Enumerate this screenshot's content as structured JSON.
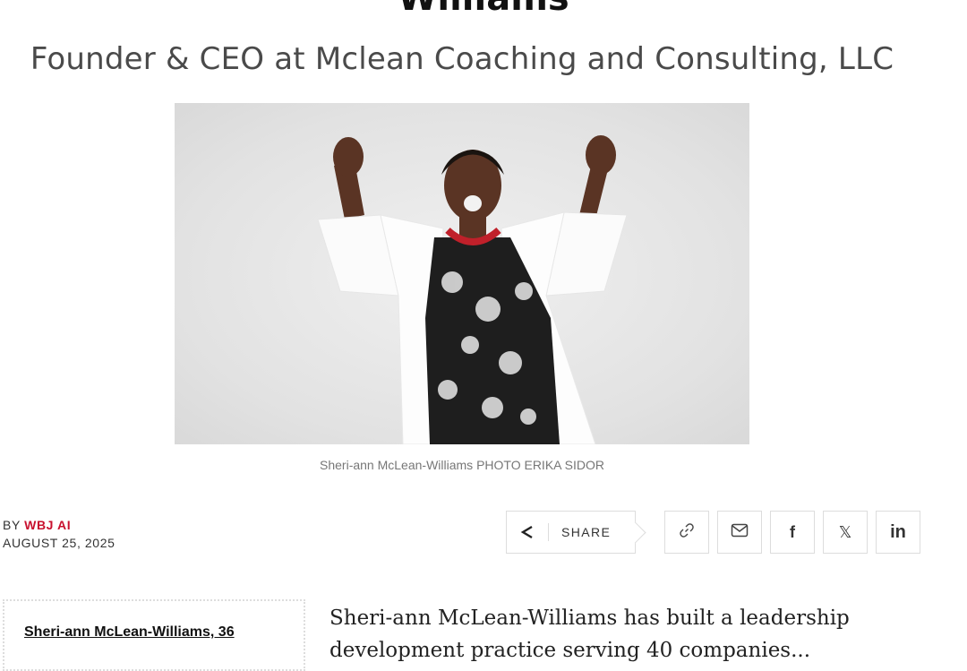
{
  "article": {
    "headline_fragment": "Williams",
    "subtitle": "Founder & CEO at Mclean Coaching and Consulting, LLC",
    "photo_caption": "Sheri-ann McLean-Williams PHOTO ERIKA SIDOR",
    "byline": {
      "by": "BY",
      "author": "WBJ AI",
      "date": "AUGUST 25, 2025"
    },
    "sidebar_name": "Sheri-ann McLean-Williams, 36",
    "body_lines": [
      "Sheri-ann McLean-Williams has built a leadership",
      "development practice serving 40 companies..."
    ]
  },
  "share": {
    "label": "SHARE",
    "buttons": [
      {
        "icon": "link-icon",
        "name": "copy-link-button"
      },
      {
        "icon": "mail-icon",
        "name": "email-share-button"
      },
      {
        "icon": "facebook-icon",
        "name": "facebook-share-button"
      },
      {
        "icon": "x-icon",
        "name": "x-share-button"
      },
      {
        "icon": "linkedin-icon",
        "name": "linkedin-share-button"
      }
    ],
    "facebook_glyph": "f",
    "x_glyph": "𝕏",
    "linkedin_glyph": "in"
  },
  "colors": {
    "accent": "#c8102e",
    "border": "#dddddd",
    "necklace": "#c0202a"
  }
}
